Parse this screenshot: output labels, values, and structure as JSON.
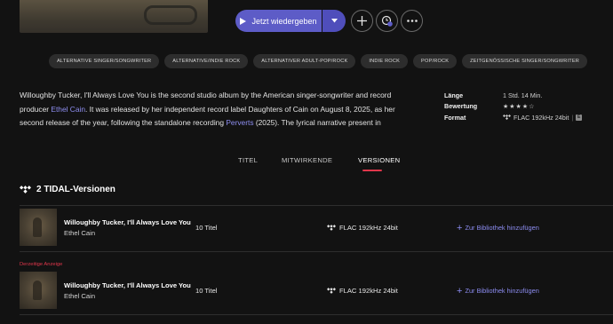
{
  "header": {
    "play_label": "Jetzt wiedergeben"
  },
  "genres": [
    "ALTERNATIVE SINGER/SONGWRITER",
    "ALTERNATIVE/INDIE ROCK",
    "ALTERNATIVER ADULT-POP/ROCK",
    "INDIE ROCK",
    "POP/ROCK",
    "ZEITGENÖSSISCHE SINGER/SONGWRITER"
  ],
  "description": {
    "p1": "Willoughby Tucker, I'll Always Love You is the second studio album by the American singer-songwriter and record producer ",
    "link1": "Ethel Cain",
    "p2": ". It was released by her independent record label Daughters of Cain on August 8, 2025, as her second release of the year, following the standalone recording ",
    "link2": "Perverts",
    "p3": " (2025). The lyrical narrative present in"
  },
  "meta": {
    "length_label": "Länge",
    "length_value": "1 Std. 14 Min.",
    "rating_label": "Bewertung",
    "rating_value": "★★★★☆",
    "format_label": "Format",
    "format_value": "FLAC 192kHz 24bit",
    "format_separator": "|",
    "explicit_badge": "E"
  },
  "tabs": {
    "titel": "TITEL",
    "mitwirkende": "MITWIRKENDE",
    "versionen": "VERSIONEN"
  },
  "versions": {
    "heading": "2 TIDAL-Versionen",
    "current_label": "Derzeitige Anzeige",
    "rows": [
      {
        "title": "Willoughby Tucker, I'll Always Love You",
        "artist": "Ethel Cain",
        "tracks": "10 Titel",
        "format": "FLAC 192kHz 24bit",
        "add": "Zur Bibliothek hinzufügen"
      },
      {
        "title": "Willoughby Tucker, I'll Always Love You",
        "artist": "Ethel Cain",
        "tracks": "10 Titel",
        "format": "FLAC 192kHz 24bit",
        "add": "Zur Bibliothek hinzufügen"
      }
    ]
  },
  "colors": {
    "accent": "#5d5cc7",
    "link": "#8e8ef0",
    "active_tab_underline": "#e0364b"
  },
  "icons": {
    "play": "play-icon",
    "dropdown": "chevron-down-icon",
    "add": "plus-icon",
    "mix": "mix-radio-icon",
    "more": "more-icon",
    "tidal": "tidal-logo-icon"
  }
}
